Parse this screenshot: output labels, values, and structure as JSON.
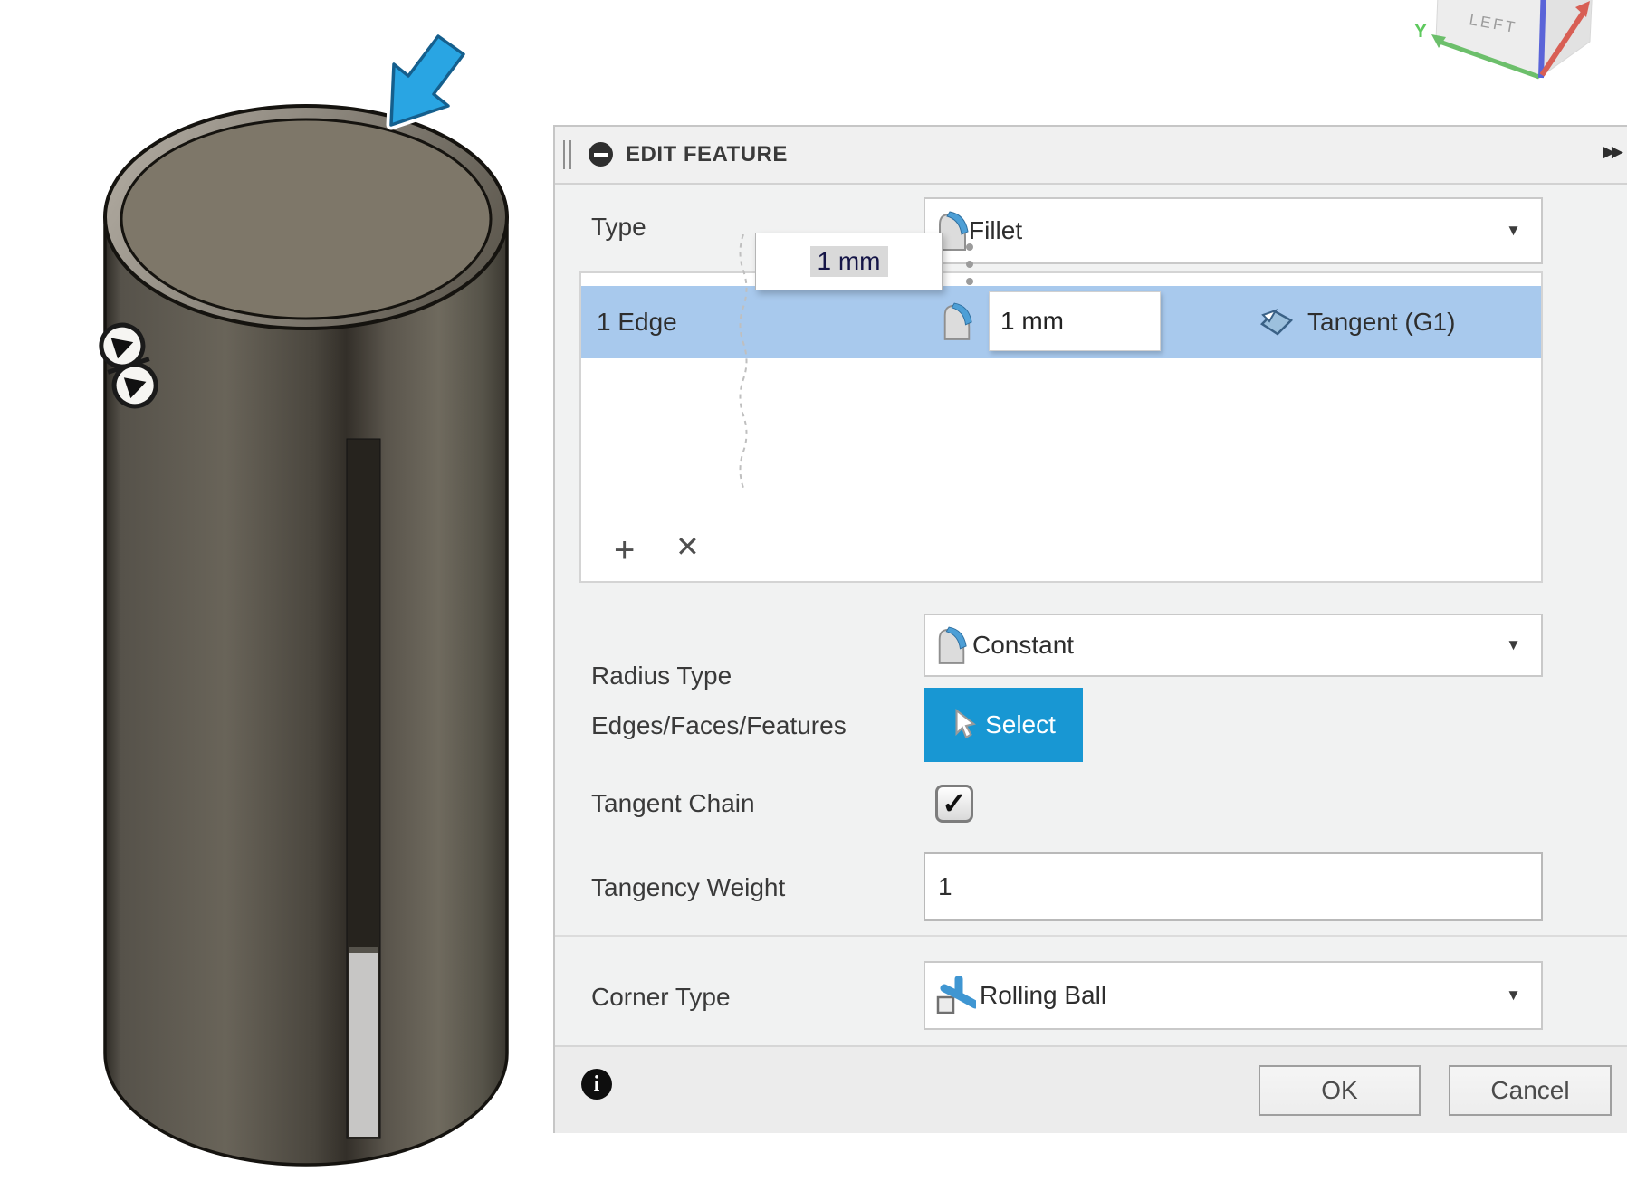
{
  "colors": {
    "accent_blue": "#1897d3",
    "selection_row_blue": "#a8c9ed",
    "arrow_blue": "#29a5e3",
    "dialog_bg": "#f1f2f2"
  },
  "viewcube": {
    "face_label": "LEFT",
    "y_axis_label": "Y"
  },
  "dialog": {
    "title": "EDIT FEATURE",
    "expand_glyph": "▶▶",
    "type_row": {
      "label": "Type",
      "value": "Fillet",
      "caret_glyph": "▼"
    },
    "floating_input": {
      "value": "1 mm"
    },
    "edge_list": {
      "selected_row": {
        "label": "1 Edge",
        "radius_value": "1 mm",
        "continuity": "Tangent (G1)"
      },
      "add_glyph": "+",
      "remove_glyph": "✕"
    },
    "radius_type_row": {
      "label": "Radius Type",
      "value": "Constant",
      "caret_glyph": "▼"
    },
    "edges_row": {
      "label": "Edges/Faces/Features",
      "button_label": "Select"
    },
    "tangent_chain_row": {
      "label": "Tangent Chain",
      "check_glyph": "✓"
    },
    "tangency_weight_row": {
      "label": "Tangency Weight",
      "value": "1"
    },
    "corner_type_row": {
      "label": "Corner Type",
      "value": "Rolling Ball",
      "caret_glyph": "▼"
    },
    "footer": {
      "info_glyph": "i",
      "ok_label": "OK",
      "cancel_label": "Cancel"
    }
  }
}
